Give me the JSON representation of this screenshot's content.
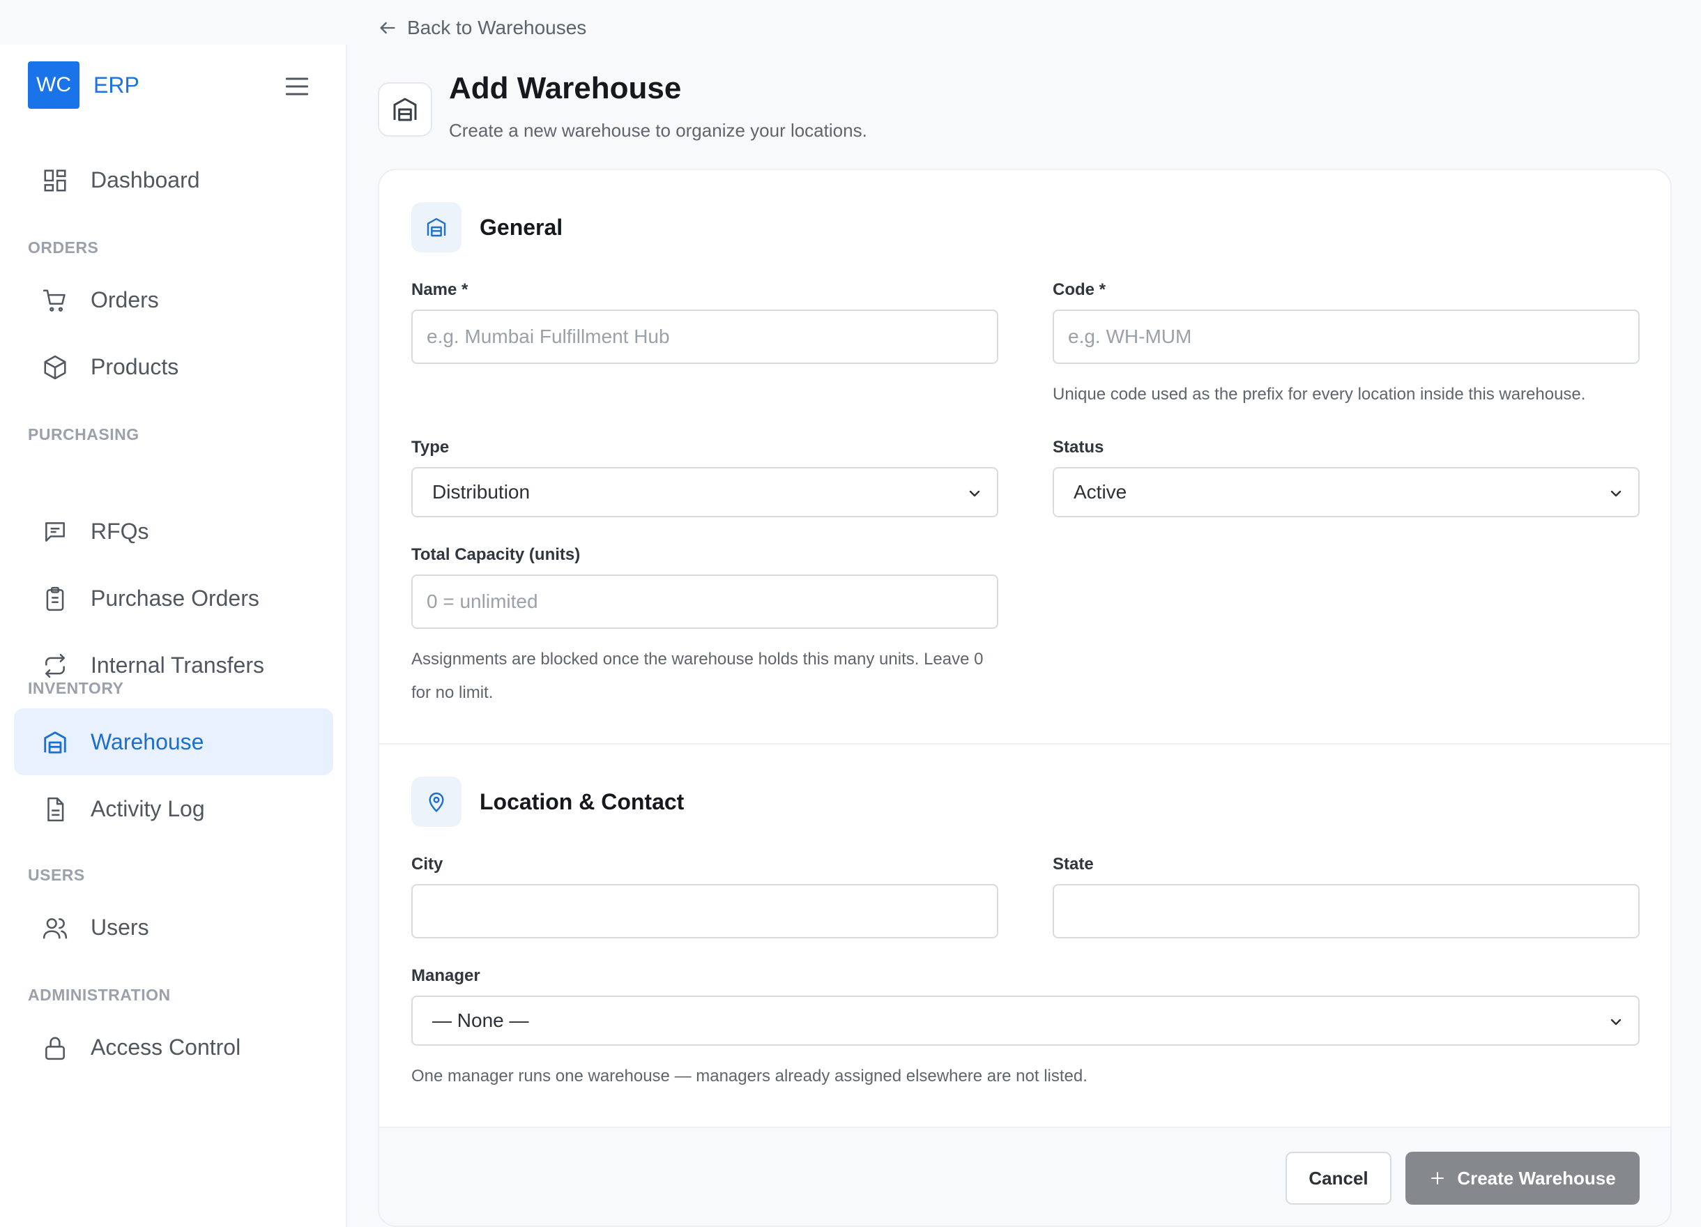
{
  "brand": {
    "badge": "WC",
    "name": "ERP"
  },
  "nav": {
    "dashboard": "Dashboard",
    "sec_orders": "ORDERS",
    "orders": "Orders",
    "products": "Products",
    "sec_purchasing": "PURCHASING",
    "rfqs": "RFQs",
    "purchase_orders": "Purchase Orders",
    "internal_transfers": "Internal Transfers",
    "sec_inventory": "INVENTORY",
    "warehouse": "Warehouse",
    "activity_log": "Activity Log",
    "sec_users": "USERS",
    "users": "Users",
    "sec_admin": "ADMINISTRATION",
    "access_control": "Access Control",
    "active_item": "Warehouse"
  },
  "header": {
    "back_label": "Back to Warehouses",
    "title": "Add Warehouse",
    "subtitle": "Create a new warehouse to organize your locations."
  },
  "general": {
    "title": "General",
    "name_label": "Name *",
    "name_placeholder": "e.g. Mumbai Fulfillment Hub",
    "code_label": "Code *",
    "code_placeholder": "e.g. WH-MUM",
    "code_help": "Unique code used as the prefix for every location inside this warehouse.",
    "type_label": "Type",
    "type_value": "Distribution",
    "status_label": "Status",
    "status_value": "Active",
    "capacity_label": "Total Capacity (units)",
    "capacity_placeholder": "0 = unlimited",
    "capacity_help": "Assignments are blocked once the warehouse holds this many units. Leave 0 for no limit."
  },
  "location": {
    "title": "Location & Contact",
    "city_label": "City",
    "city_value": "",
    "state_label": "State",
    "state_value": "",
    "manager_label": "Manager",
    "manager_value": "— None —",
    "manager_help": "One manager runs one warehouse — managers already assigned elsewhere are not listed."
  },
  "footer": {
    "cancel_label": "Cancel",
    "create_label": "Create Warehouse"
  },
  "colors": {
    "accent": "#1a73e8",
    "active_bg": "#e8f1fd",
    "disabled_button": "#85888c"
  }
}
